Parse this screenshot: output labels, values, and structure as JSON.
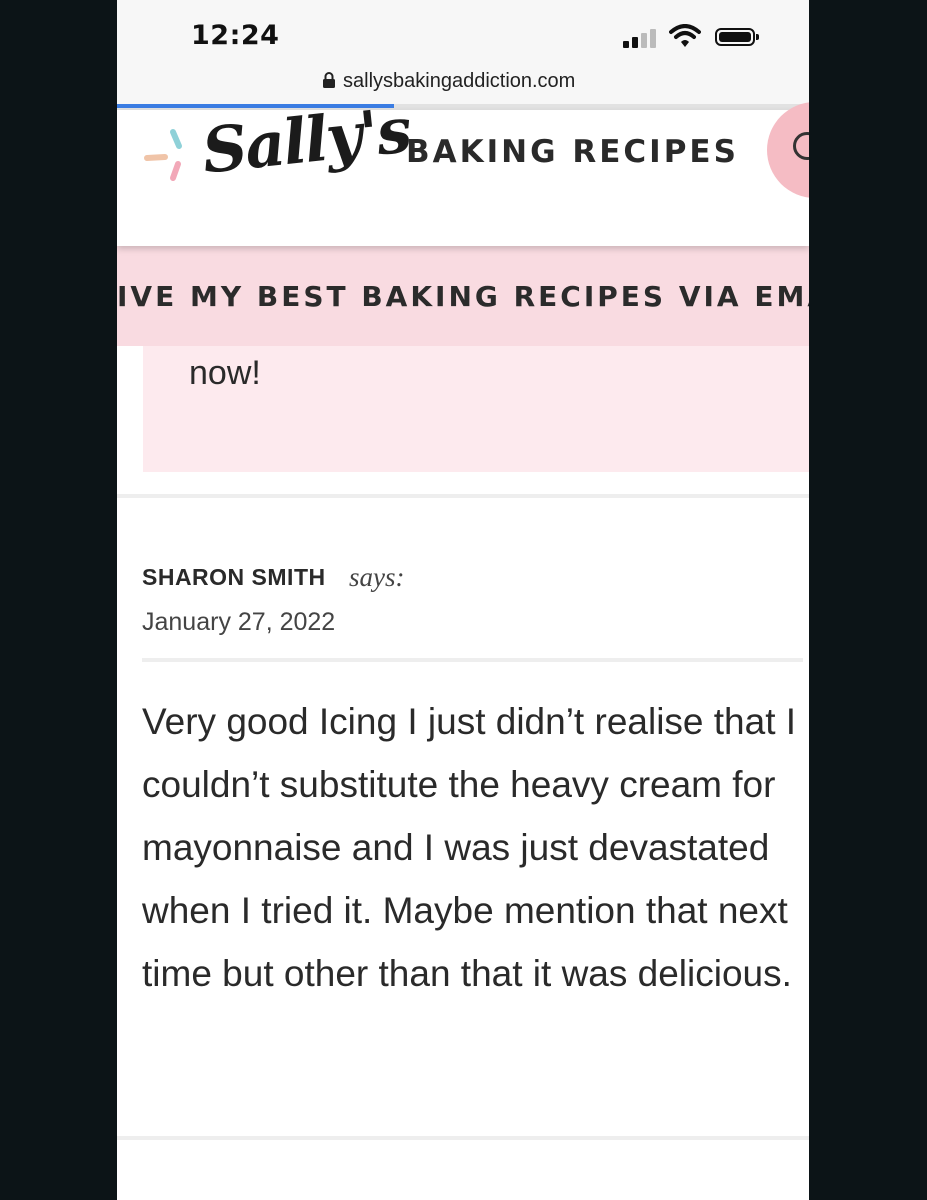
{
  "status_bar": {
    "time": "12:24",
    "signal_icon": "cellular-signal-icon",
    "wifi_icon": "wifi-icon",
    "battery_icon": "battery-icon"
  },
  "browser": {
    "url": "sallysbakingaddiction.com",
    "lock_icon": "lock-icon",
    "load_progress": 0.4
  },
  "site_header": {
    "logo_script": "Sally's",
    "logo_text": "BAKING RECIPES",
    "search_icon": "search-icon"
  },
  "email_banner": {
    "text": "IVE MY BEST BAKING RECIPES VIA EMAI"
  },
  "promo_box": {
    "text": "now!"
  },
  "comment": {
    "author": "SHARON SMITH",
    "says": "says:",
    "date": "January 27, 2022",
    "body": "Very good Icing I just didn’t realise that I couldn’t substitute the heavy cream for mayonnaise and I was just devastated when I tried it. Maybe mention that next time but other than that it was delicious."
  },
  "colors": {
    "background": "#0c1417",
    "accent_pink": "#f5bcc4",
    "banner_pink": "#f9dbe1",
    "promo_pink": "#fdeaee",
    "progress_blue": "#3b7de3"
  }
}
